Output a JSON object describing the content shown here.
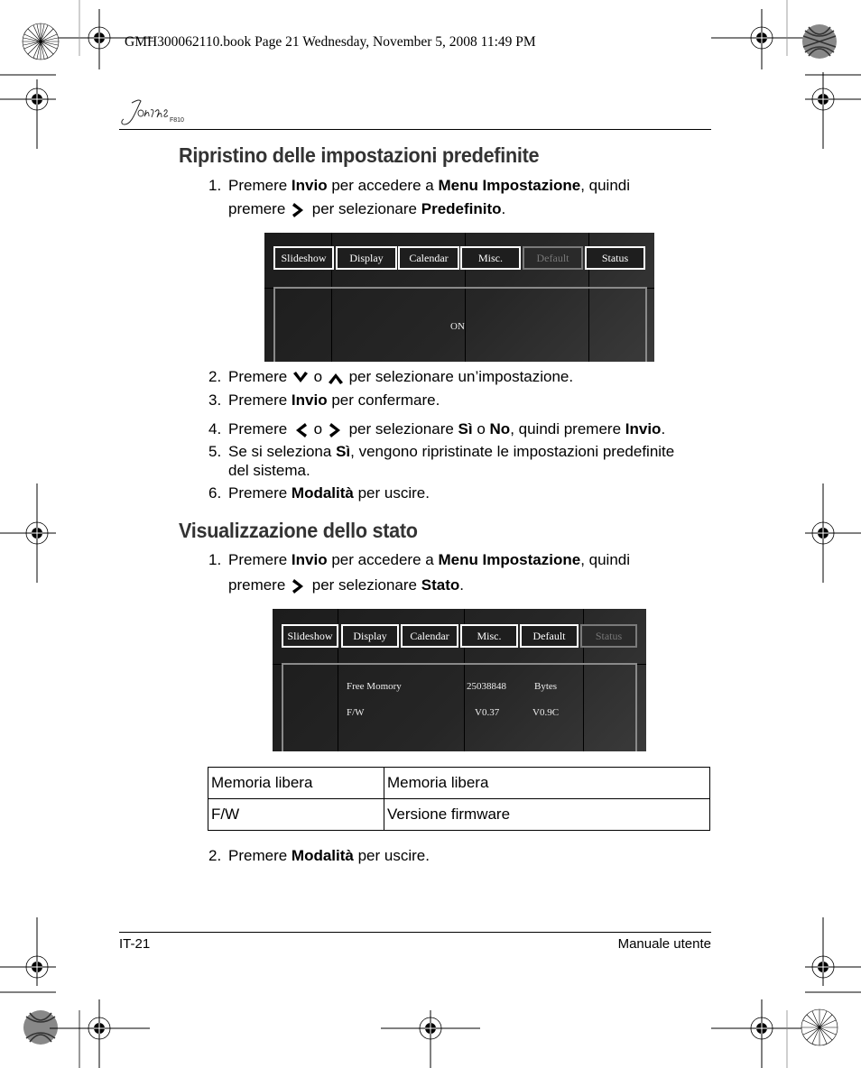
{
  "slug": "GMH300062110.book  Page 21  Wednesday, November 5, 2008  11:49 PM",
  "header": {
    "brand": "Journe",
    "model": "F810"
  },
  "section1": {
    "title": "Ripristino delle impostazioni predefinite",
    "steps": [
      {
        "num": "1.",
        "parts": [
          "Premere ",
          "Invio",
          " per accedere a ",
          "Menu Impostazione",
          ", quindi"
        ],
        "line2": [
          "premere ",
          "right-arrow-icon",
          " per selezionare ",
          "Predefinito",
          "."
        ]
      },
      {
        "num": "2.",
        "text_a": "Premere ",
        "icon_a": "down-arrow-icon",
        "text_b": " o ",
        "icon_b": "up-arrow-icon",
        "text_c": " per selezionare un’impostazione."
      },
      {
        "num": "3.",
        "text_a": "Premere ",
        "bold": "Invio",
        "text_b": " per confermare."
      },
      {
        "num": "4.",
        "text_a": "Premere ",
        "icon_a": "left-arrow-icon",
        "text_b": " o ",
        "icon_b": "right-arrow-icon",
        "text_c": " per selezionare ",
        "bold1": "Sì",
        "text_d": " o ",
        "bold2": "No",
        "text_e": ", quindi premere ",
        "bold3": "Invio",
        "text_f": "."
      },
      {
        "num": "5.",
        "text_a": "Se si seleziona ",
        "bold": "Sì",
        "text_b": ", vengono ripristinate le impostazioni predefinite",
        "line2": "del sistema."
      },
      {
        "num": "6.",
        "text_a": "Premere ",
        "bold": "Modalità",
        "text_b": " per uscire."
      }
    ],
    "screen": {
      "tabs": [
        "Slideshow",
        "Display",
        "Calendar",
        "Misc.",
        "Default",
        "Status"
      ],
      "selected_tab": "Default",
      "value": "ON"
    }
  },
  "section2": {
    "title": "Visualizzazione dello stato",
    "step1": {
      "num": "1.",
      "a": "Premere ",
      "b": "Invio",
      "c": " per accedere a ",
      "d": "Menu Impostazione",
      "e": ", quindi",
      "f": "premere ",
      "g": " per selezionare ",
      "h": "Stato",
      "i": "."
    },
    "screen": {
      "tabs": [
        "Slideshow",
        "Display",
        "Calendar",
        "Misc.",
        "Default",
        "Status"
      ],
      "selected_tab": "Status",
      "rows": [
        {
          "label": "Free Momory",
          "value": "25038848",
          "unit": "Bytes"
        },
        {
          "label": "F/W",
          "value": "V0.37",
          "unit": "V0.9C"
        }
      ]
    },
    "table": [
      [
        "Memoria libera",
        "Memoria libera"
      ],
      [
        "F/W",
        "Versione firmware"
      ]
    ],
    "step2": {
      "num": "2.",
      "a": "Premere ",
      "b": "Modalità",
      "c": " per uscire."
    }
  },
  "footer": {
    "page": "IT-21",
    "title": "Manuale utente"
  }
}
